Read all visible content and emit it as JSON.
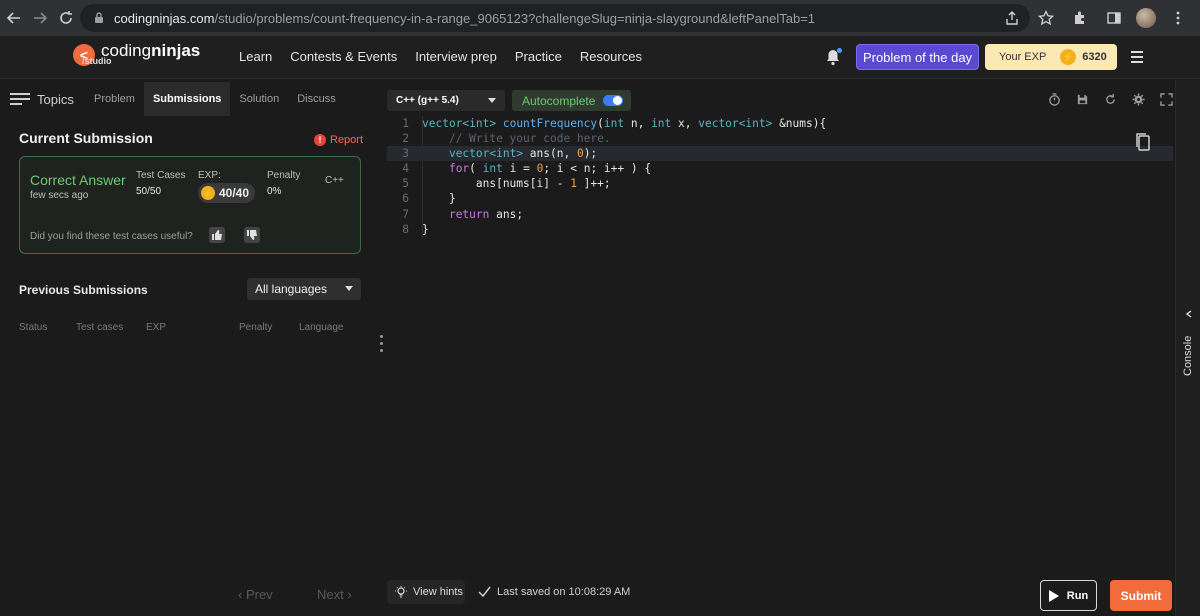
{
  "browser": {
    "url_host": "codingninjas.com",
    "url_path": "/studio/problems/count-frequency-in-a-range_9065123?challengeSlug=ninja-slayground&leftPanelTab=1"
  },
  "header": {
    "logo_main": "coding",
    "logo_bold": "ninjas",
    "logo_sub": "/studio",
    "nav": [
      "Learn",
      "Contests & Events",
      "Interview prep",
      "Practice",
      "Resources"
    ],
    "problem_of_day": "Problem of the day",
    "exp_label": "Your EXP",
    "exp_value": "6320"
  },
  "left": {
    "topics_label": "Topics",
    "tabs": [
      "Problem",
      "Submissions",
      "Solution",
      "Discuss"
    ],
    "active_tab": "Submissions",
    "current_title": "Current Submission",
    "report_label": "Report",
    "card": {
      "result": "Correct Answer",
      "time": "few secs ago",
      "test_cases_label": "Test Cases",
      "test_cases_value": "50/50",
      "exp_label": "EXP:",
      "exp_value": "40/40",
      "penalty_label": "Penalty",
      "penalty_value": "0%",
      "language": "C++",
      "useful_question": "Did you find these test cases useful?"
    },
    "previous_title": "Previous Submissions",
    "language_filter": "All languages",
    "columns": [
      "Status",
      "Test cases",
      "EXP",
      "Penalty",
      "Language"
    ],
    "prev_label": "Prev",
    "next_label": "Next"
  },
  "editor": {
    "language": "C++ (g++ 5.4)",
    "autocomplete_label": "Autocomplete",
    "autocomplete_on": true,
    "line_numbers": [
      "1",
      "2",
      "3",
      "4",
      "5",
      "6",
      "7",
      "8"
    ]
  },
  "code_lines": [
    [
      [
        "ty",
        "vector<int>"
      ],
      [
        "vr",
        " "
      ],
      [
        "fn",
        "countFrequency"
      ],
      [
        "vr",
        "("
      ],
      [
        "ty",
        "int"
      ],
      [
        "vr",
        " n, "
      ],
      [
        "ty",
        "int"
      ],
      [
        "vr",
        " x, "
      ],
      [
        "ty",
        "vector<int>"
      ],
      [
        "vr",
        " &nums){"
      ]
    ],
    [
      [
        "cm",
        "    // Write your code here."
      ]
    ],
    [
      [
        "vr",
        "    "
      ],
      [
        "ty",
        "vector<int>"
      ],
      [
        "vr",
        " ans(n, "
      ],
      [
        "nm",
        "0"
      ],
      [
        "vr",
        ");"
      ]
    ],
    [
      [
        "vr",
        "    "
      ],
      [
        "kw",
        "for"
      ],
      [
        "vr",
        "( "
      ],
      [
        "ty",
        "int"
      ],
      [
        "vr",
        " i = "
      ],
      [
        "nm",
        "0"
      ],
      [
        "vr",
        "; i < n; i++ ) {"
      ]
    ],
    [
      [
        "vr",
        "        ans[nums[i] - "
      ],
      [
        "nm",
        "1"
      ],
      [
        "vr",
        " ]++;"
      ]
    ],
    [
      [
        "vr",
        "    }"
      ]
    ],
    [
      [
        "vr",
        "    "
      ],
      [
        "kw",
        "return"
      ],
      [
        "vr",
        " ans;"
      ]
    ],
    [
      [
        "vr",
        "}"
      ]
    ]
  ],
  "console_label": "Console",
  "bottom": {
    "view_hints": "View hints",
    "last_saved": "Last saved on 10:08:29 AM",
    "run_label": "Run",
    "submit_label": "Submit"
  },
  "colors": {
    "accent_orange": "#f26b3a",
    "purple": "#5b4ad1",
    "success_green": "#6ccb70",
    "report_red": "#e5443b"
  }
}
